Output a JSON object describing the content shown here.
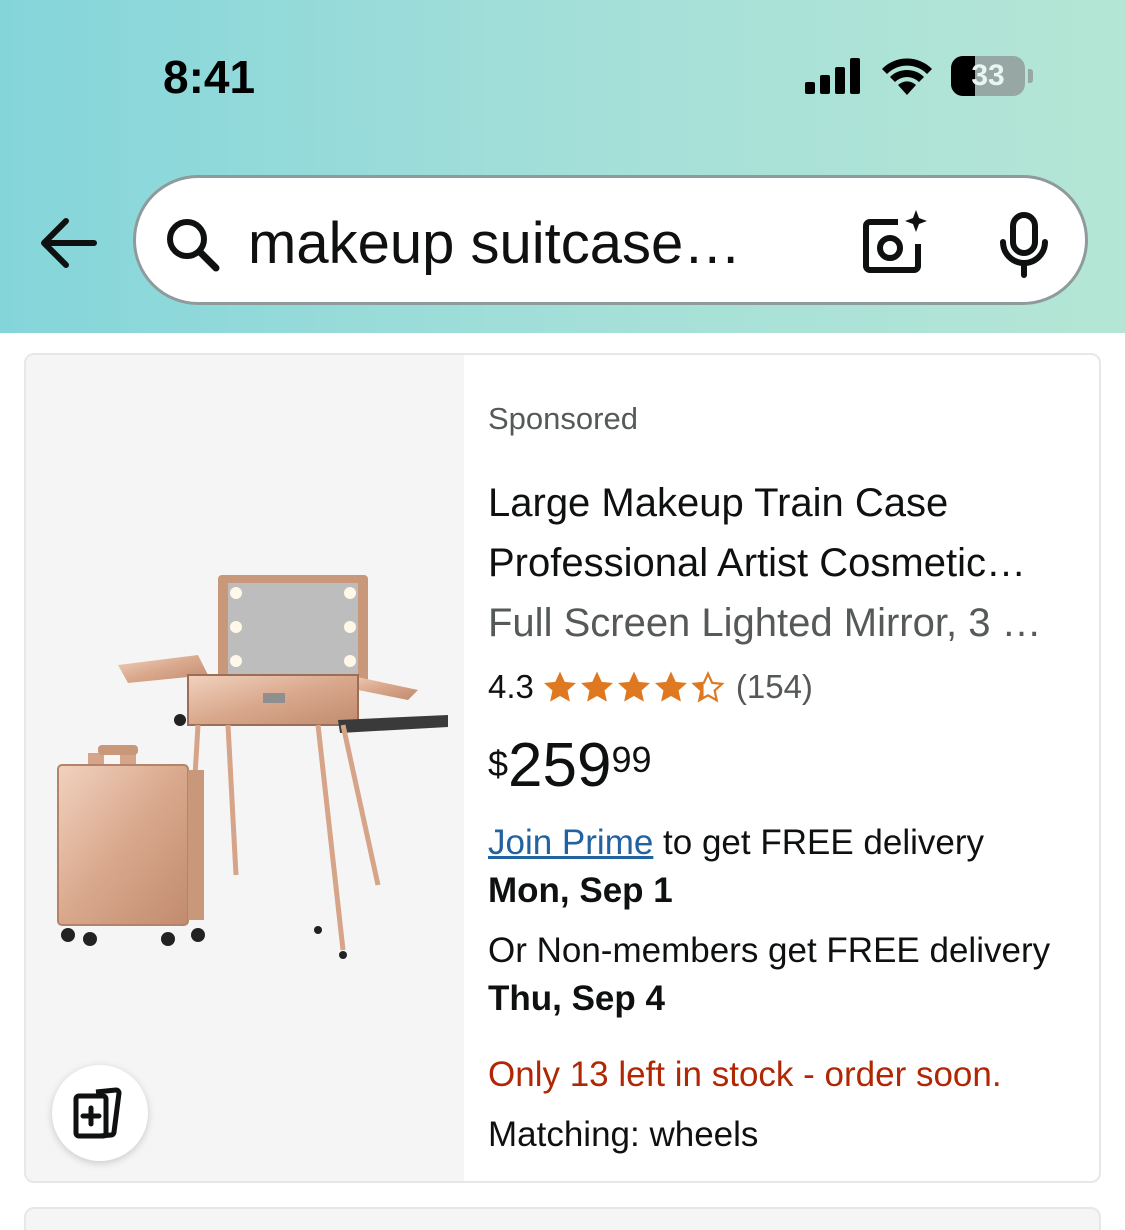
{
  "status_bar": {
    "time": "8:41",
    "battery": "33"
  },
  "search": {
    "query": "makeup suitcase…",
    "icons": [
      "back-arrow-icon",
      "search-icon",
      "camera-sparkle-icon",
      "microphone-icon"
    ]
  },
  "product": {
    "sponsored": "Sponsored",
    "title_line1": "Large Makeup Train Case",
    "title_line2": "Professional Artist Cosmetic…",
    "title_line3": "Full Screen Lighted Mirror, 3 …",
    "rating": "4.3",
    "rating_value": 4.3,
    "rating_count": "(154)",
    "price_symbol": "$",
    "price_whole": "259",
    "price_fraction": "99",
    "prime_link": "Join Prime",
    "prime_text": " to get FREE delivery",
    "delivery_date_prime": "Mon, Sep 1",
    "nonmember_text": "Or Non-members get FREE delivery",
    "delivery_date_nonmember": "Thu, Sep 4",
    "stock": "Only 13 left in stock - order soon.",
    "matching": "Matching: wheels"
  },
  "colors": {
    "header_gradient_start": "#84d5da",
    "header_gradient_end": "#b5e6d5",
    "star": "#de7921",
    "link": "#2162a1",
    "stock_red": "#b12704"
  }
}
